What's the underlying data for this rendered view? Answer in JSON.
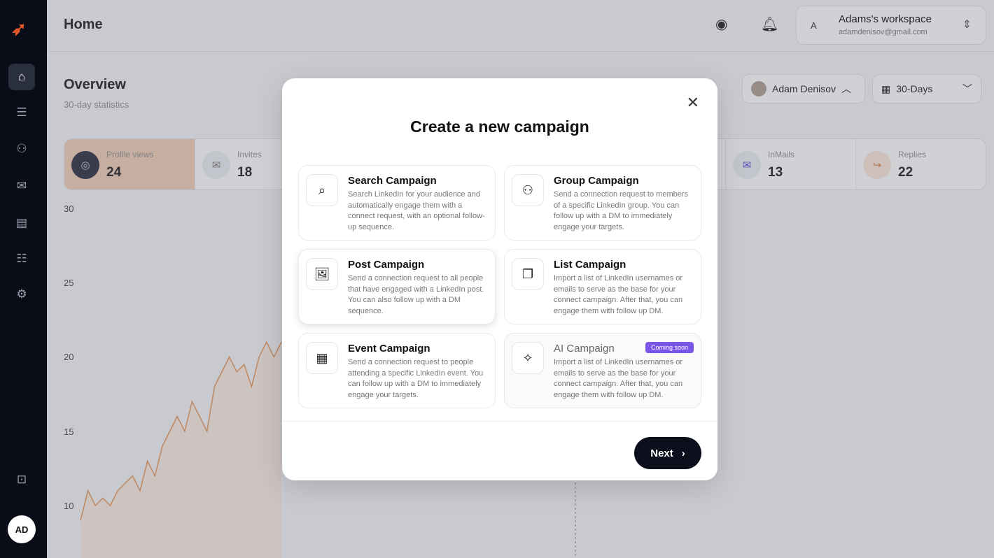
{
  "sidebar": {
    "avatar_initials": "AD",
    "items": [
      "home",
      "campaigns",
      "network",
      "inbox",
      "archive",
      "contacts",
      "settings"
    ]
  },
  "header": {
    "title": "Home",
    "workspace": {
      "initial": "A",
      "name": "Adams's workspace",
      "email": "adamdenisov@gmail.com"
    }
  },
  "overview": {
    "title": "Overview",
    "subtitle": "30-day statistics",
    "user_filter": "Adam Denisov",
    "period_filter": "30-Days"
  },
  "stats": [
    {
      "label": "Profile views",
      "value": "24",
      "icon": "eye-icon"
    },
    {
      "label": "Invites",
      "value": "18",
      "icon": "envelope-open-icon"
    },
    {
      "label": "InMails",
      "value": "13",
      "icon": "mail-icon"
    },
    {
      "label": "Replies",
      "value": "22",
      "icon": "reply-icon"
    }
  ],
  "chart_data": {
    "type": "line",
    "yticks": [
      "30",
      "25",
      "20",
      "15",
      "10"
    ],
    "ylim": [
      8,
      30
    ],
    "series": [
      {
        "color": "#e8a06a",
        "values": [
          9,
          11,
          10,
          10.5,
          10,
          11,
          11.5,
          12,
          11,
          13,
          12,
          14,
          15,
          16,
          15,
          17,
          16,
          15,
          18,
          19,
          20,
          19,
          19.5,
          18,
          20,
          21,
          20,
          21
        ]
      }
    ]
  },
  "modal": {
    "title": "Create a new campaign",
    "cards": [
      {
        "title": "Search Campaign",
        "desc": "Search LinkedIn for your audience and automatically engage them with a connect request, with an optional follow-up sequence."
      },
      {
        "title": "Group Campaign",
        "desc": "Send a connection request to members of a specific LinkedIn group. You can follow up with a DM to immediately engage your targets."
      },
      {
        "title": "Post Campaign",
        "desc": "Send a connection request to all people that have engaged with a LinkedIn post. You can also follow up with a DM sequence."
      },
      {
        "title": "List Campaign",
        "desc": "Import a list of LinkedIn usernames or emails to serve as the base for your connect campaign. After that, you can engage them with follow up DM."
      },
      {
        "title": "Event Campaign",
        "desc": "Send a connection request to people attending a specific LinkedIn event. You can follow up with a DM to immediately engage your targets."
      },
      {
        "title": "AI Campaign",
        "desc": "Import a list of LinkedIn usernames or emails to serve as the base for your connect campaign. After that, you can engage them with follow up DM.",
        "badge": "Coming soon"
      }
    ],
    "next_label": "Next"
  }
}
